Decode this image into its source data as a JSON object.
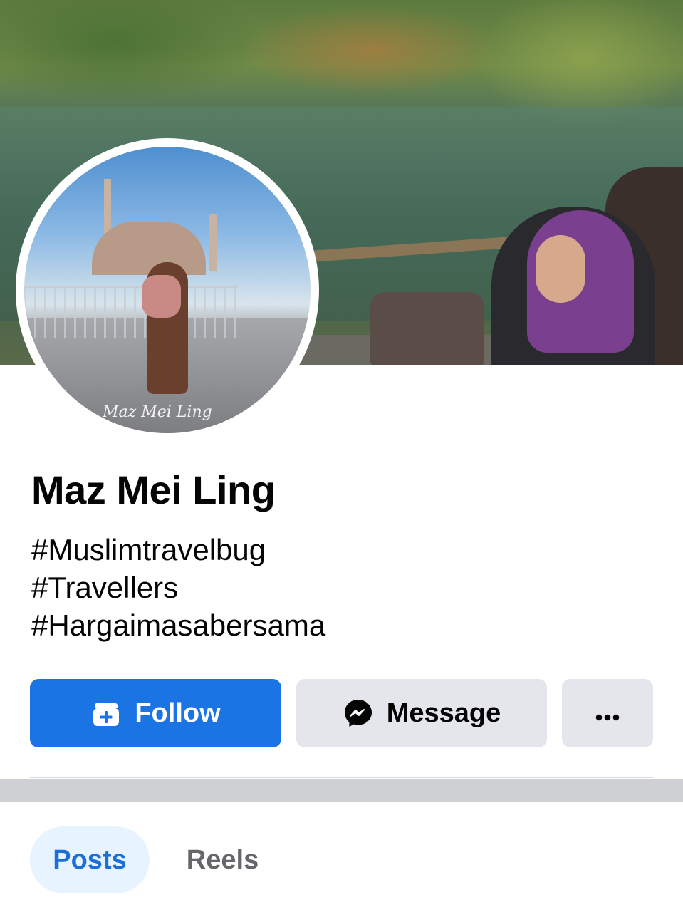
{
  "profile": {
    "name": "Maz Mei Ling",
    "avatar_signature": "Maz Mei Ling",
    "bio": [
      "#Muslimtravelbug",
      "#Travellers",
      "#Hargaimasabersama"
    ]
  },
  "actions": {
    "follow_label": "Follow",
    "follow_icon": "add-friend-icon",
    "message_label": "Message",
    "message_icon": "messenger-icon",
    "more_icon": "more-options-icon"
  },
  "tabs": [
    {
      "label": "Posts",
      "active": true
    },
    {
      "label": "Reels",
      "active": false
    }
  ],
  "colors": {
    "primary": "#1b74e4",
    "secondary_button": "#e4e6eb",
    "active_tab_bg": "#e7f3ff",
    "active_tab_text": "#1b6fd8",
    "inactive_tab_text": "#65676b"
  }
}
